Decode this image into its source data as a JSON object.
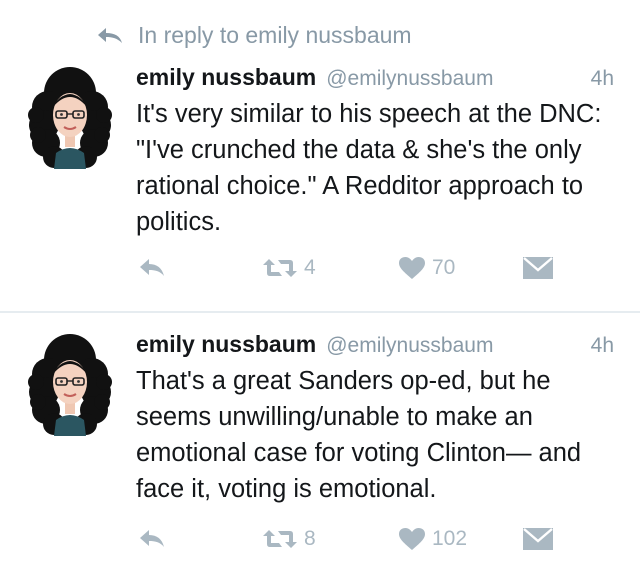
{
  "reply_context": {
    "icon": "reply-arrow-icon",
    "text": "In reply to emily nussbaum"
  },
  "tweets": [
    {
      "name": "emily nussbaum",
      "handle": "@emilynussbaum",
      "time": "4h",
      "text": "It's very similar to his speech at the DNC: \"I've crunched the data & she's the only rational choice.\" A Redditor approach to politics.",
      "retweets": "4",
      "likes": "70"
    },
    {
      "name": "emily nussbaum",
      "handle": "@emilynussbaum",
      "time": "4h",
      "text": "That's a great Sanders op-ed, but he seems unwilling/unable to make an emotional case for voting Clinton— and face it, voting is emotional.",
      "retweets": "8",
      "likes": "102"
    }
  ],
  "colors": {
    "muted": "#8899a6",
    "icon": "#aab8c2",
    "text": "#14171a",
    "divider": "#e6ecf0"
  }
}
